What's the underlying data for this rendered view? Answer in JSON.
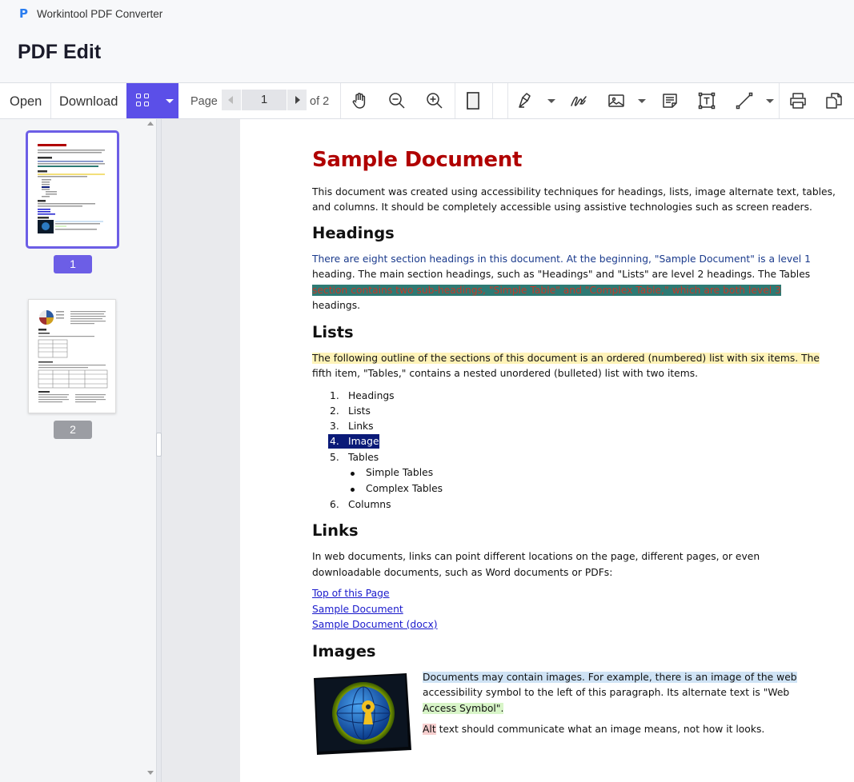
{
  "app": {
    "name": "Workintool PDF Converter",
    "logo_glyph": "P"
  },
  "header": {
    "title": "PDF Edit"
  },
  "toolbar": {
    "open_label": "Open",
    "download_label": "Download",
    "page_label": "Page",
    "current_page": "1",
    "of_label": "of 2",
    "tools": [
      "hand-icon",
      "zoom-out-icon",
      "zoom-in-icon",
      "fit-page-icon",
      "highlighter-icon",
      "signature-icon",
      "image-icon",
      "note-icon",
      "text-box-icon",
      "line-icon",
      "print-icon",
      "copy-icon"
    ]
  },
  "sidebar": {
    "pages": [
      {
        "number": "1",
        "selected": true
      },
      {
        "number": "2",
        "selected": false
      }
    ]
  },
  "document": {
    "title": "Sample Document",
    "intro": [
      "This document was created using accessibility techniques for headings, lists, image alternate text, tables,",
      "and columns. It should be completely accessible using assistive technologies such as screen readers."
    ],
    "headings_title": "Headings",
    "headings_p1": "There are eight section headings in this document. At the beginning, \"Sample Document\" is a level 1",
    "headings_p2": "heading. The main section headings, such as \"Headings\" and \"Lists\" are level 2 headings. The Tables",
    "headings_p3": "section contains two sub-headings, \"Simple Table\" and \"Complex Table,\" which are both level 3",
    "headings_p4": "headings.",
    "lists_title": "Lists",
    "lists_p1": "The following outline of the sections of this document is an ordered (numbered) list with six items. The",
    "lists_p2": "fifth item, \"Tables,\" contains a nested unordered (bulleted) list with two items.",
    "list_items": [
      {
        "num": "1.",
        "text": "Headings"
      },
      {
        "num": "2.",
        "text": "Lists"
      },
      {
        "num": "3.",
        "text": "Links"
      },
      {
        "num": "4.",
        "text": "Images"
      },
      {
        "num": "5.",
        "text": "Tables"
      },
      {
        "num": "6.",
        "text": "Columns"
      }
    ],
    "sub_items": [
      "Simple Tables",
      "Complex Tables"
    ],
    "links_title": "Links",
    "links_p1": "In web documents, links can point different locations on the page, different pages, or even",
    "links_p2": "downloadable documents, such as Word documents or PDFs:",
    "links": [
      "Top of this Page",
      "Sample Document",
      "Sample Document (docx)"
    ],
    "images_title": "Images",
    "images_p1a": "Documents may contain images. For example, there is an image of the web",
    "images_p2": "accessibility symbol to the left of this paragraph. Its alternate text is \"Web",
    "images_p3": "Access Symbol\".",
    "images_p4a": "Alt",
    "images_p4b": " text should communicate what an image means, not how it looks."
  },
  "colors": {
    "accent": "#5b4fe8",
    "title_red": "#b00000",
    "link_blue": "#1a1acc"
  }
}
